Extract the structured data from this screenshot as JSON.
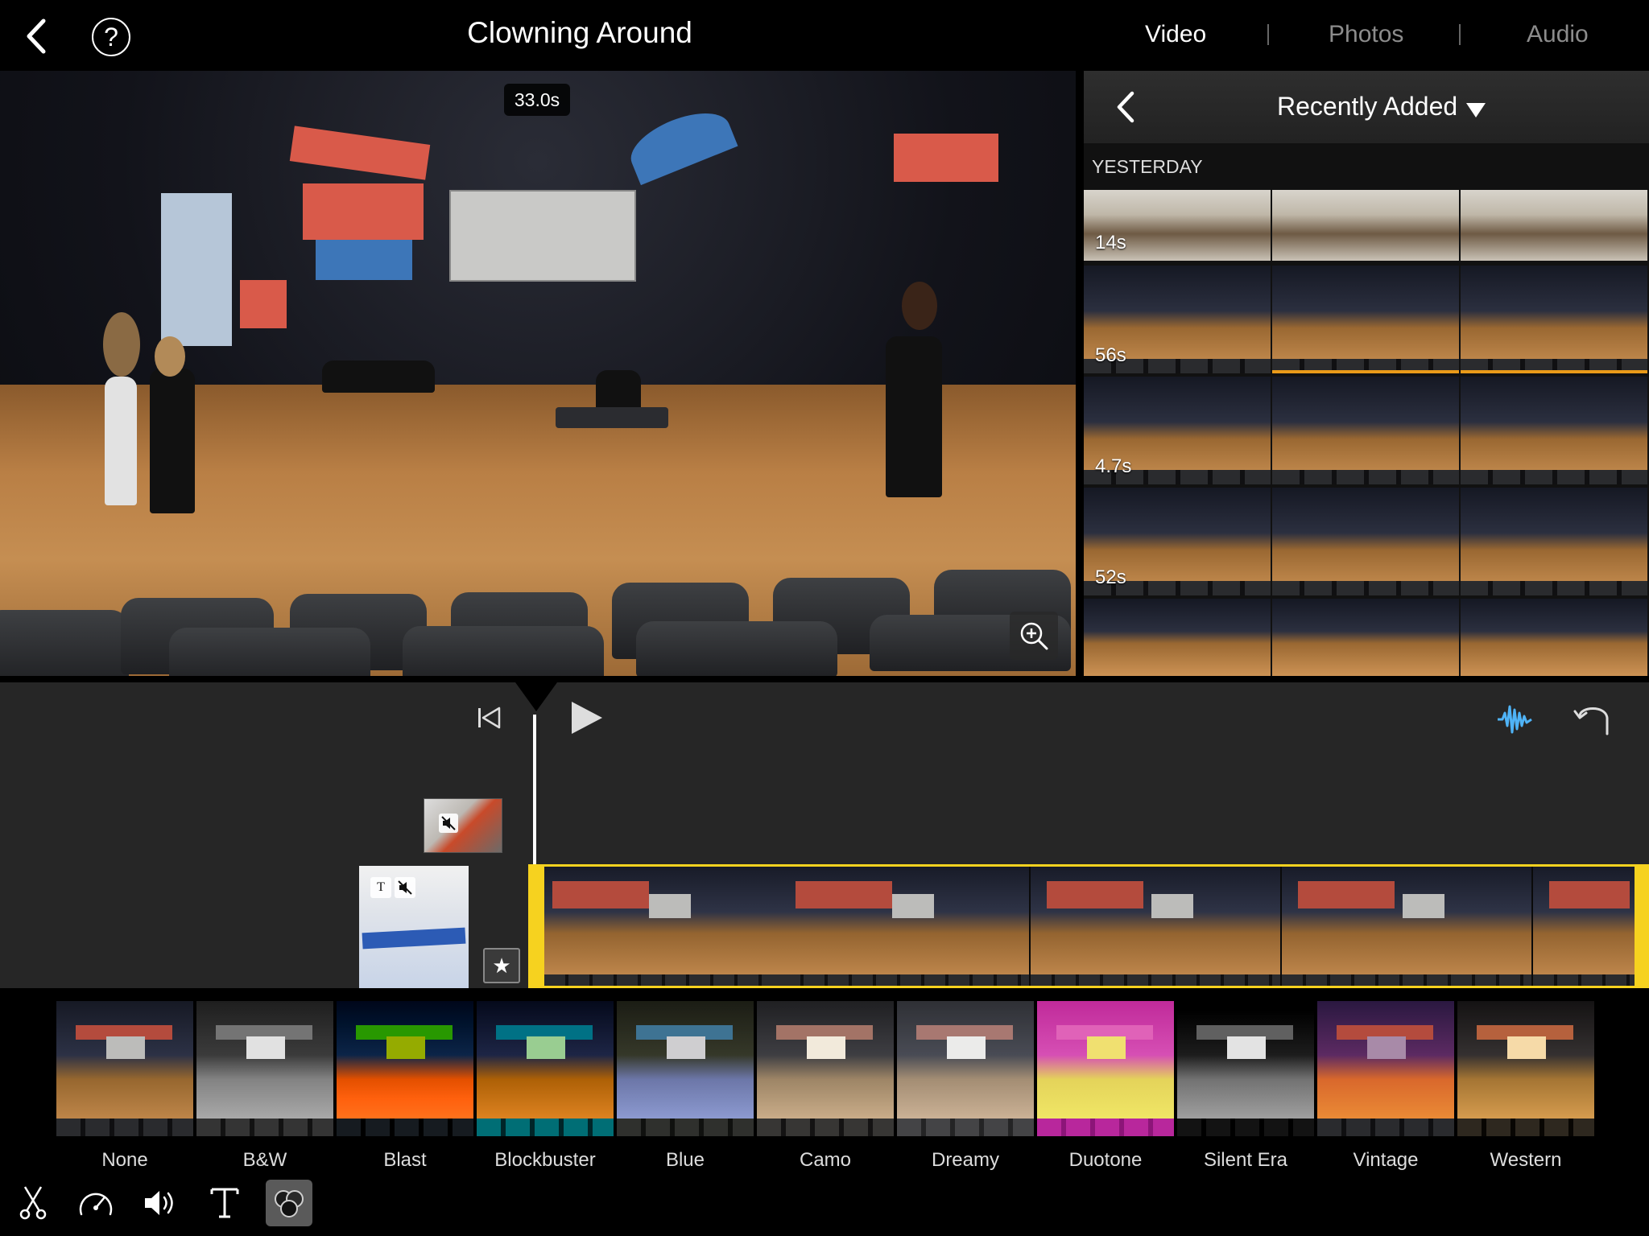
{
  "app": {
    "title": "Clowning Around"
  },
  "header": {
    "tabs": [
      {
        "label": "Video",
        "active": true
      },
      {
        "label": "Photos",
        "active": false
      },
      {
        "label": "Audio",
        "active": false
      }
    ]
  },
  "viewer": {
    "time_badge": "33.0s"
  },
  "browser": {
    "title": "Recently Added",
    "section": "YESTERDAY",
    "clips": [
      {
        "duration": "14s"
      },
      {
        "duration": "56s"
      },
      {
        "duration": "4.7s"
      },
      {
        "duration": "52s"
      }
    ]
  },
  "filters": {
    "selected": "None",
    "items": [
      {
        "label": "None"
      },
      {
        "label": "B&W"
      },
      {
        "label": "Blast"
      },
      {
        "label": "Blockbuster"
      },
      {
        "label": "Blue"
      },
      {
        "label": "Camo"
      },
      {
        "label": "Dreamy"
      },
      {
        "label": "Duotone"
      },
      {
        "label": "Silent Era"
      },
      {
        "label": "Vintage"
      },
      {
        "label": "Western"
      }
    ]
  },
  "colors": {
    "accent_yellow": "#f6d21f",
    "waveform_blue": "#4fb3f6",
    "used_clip_orange": "#e99a19"
  },
  "icons": {
    "toolbar": [
      "scissors-icon",
      "speedometer-icon",
      "speaker-icon",
      "title-text-icon",
      "filters-icon"
    ]
  }
}
